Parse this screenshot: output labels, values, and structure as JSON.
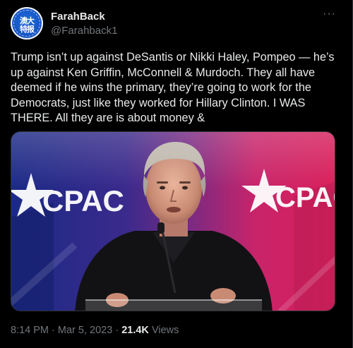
{
  "author": {
    "display_name": "FarahBack",
    "handle": "@Farahback1",
    "avatar_icon": "avatar-logo-icon"
  },
  "menu": {
    "more_glyph": "···",
    "more_icon": "more-options-icon"
  },
  "tweet": {
    "text": "Trump isn’t up against DeSantis or Nikki Haley, Pompeo — he’s up against Ken Griffin, McConnell & Murdoch. They all have deemed if he wins the primary, they’re going to work for the Democrats, just like they worked for Hillary Clinton. I WAS THERE. All they are is about money &"
  },
  "media": {
    "banner_left": "CPAC",
    "banner_right": "CPAC"
  },
  "meta": {
    "time": "8:14 PM",
    "separator": "·",
    "date": "Mar 5, 2023",
    "views_count": "21.4K",
    "views_label": "Views"
  },
  "colors": {
    "background": "#000000",
    "text_primary": "#e7e9ea",
    "text_secondary": "#71767b",
    "border": "#2f3336",
    "cpac_red": "#e8204a",
    "cpac_blue": "#1d2f8f"
  }
}
